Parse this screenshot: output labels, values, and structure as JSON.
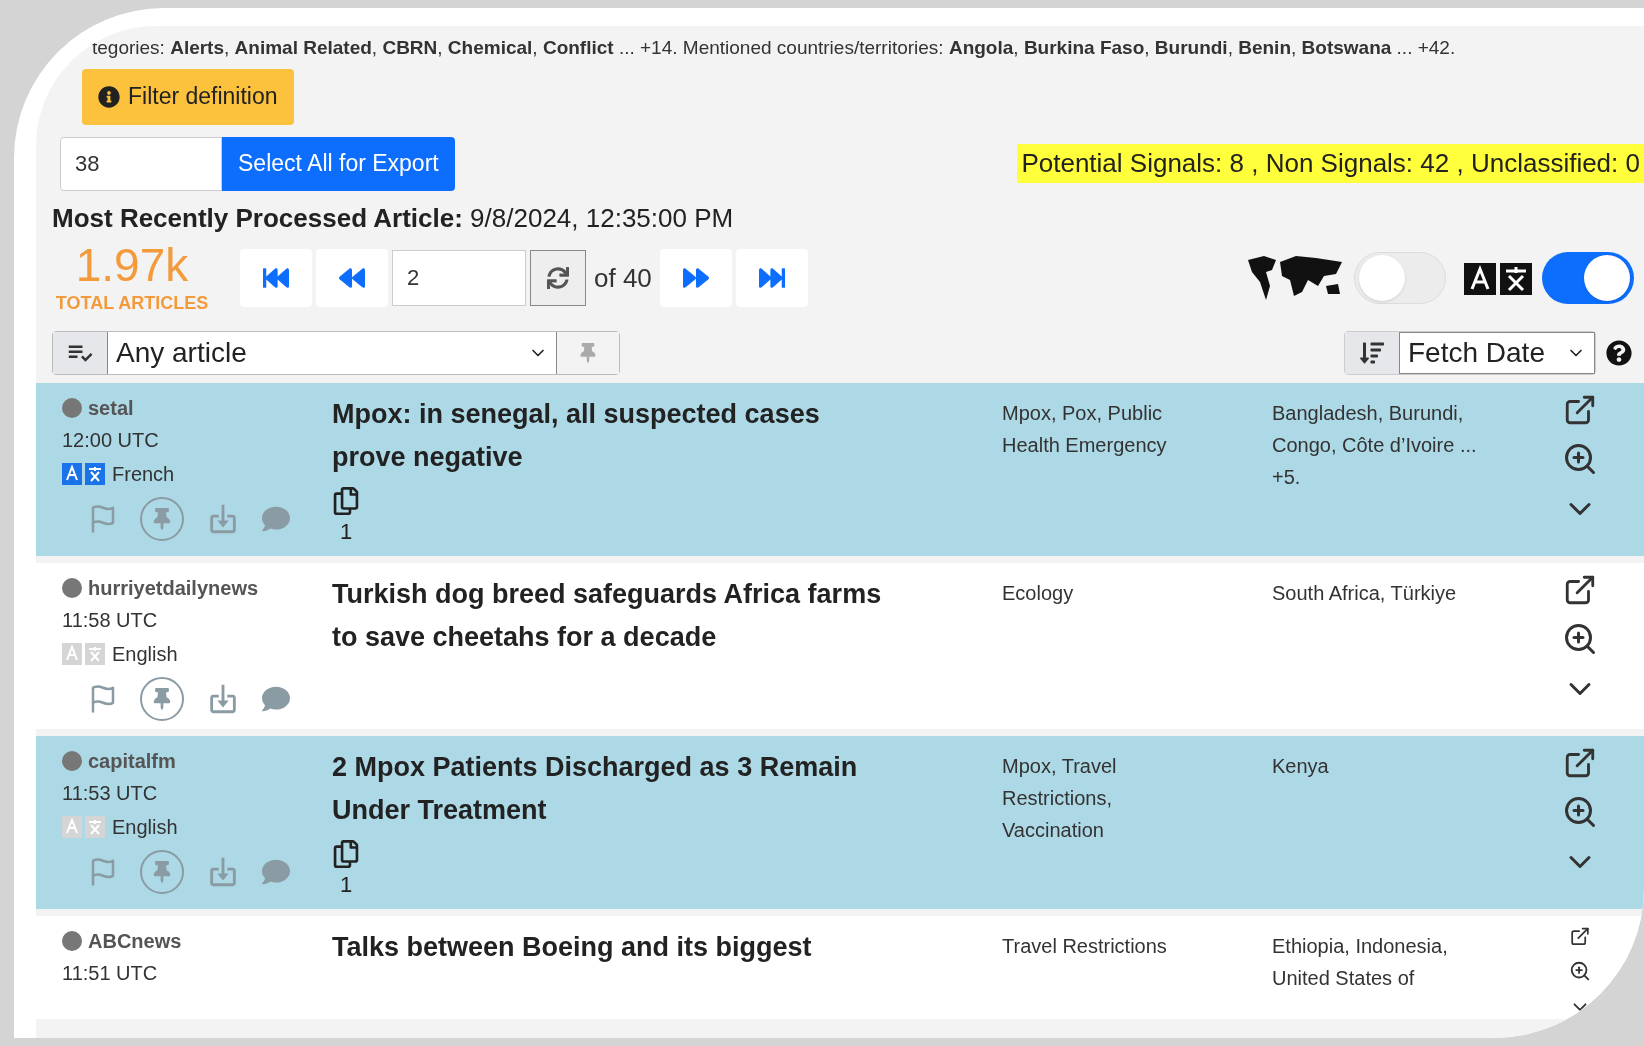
{
  "filter_summary": "tegories: **Alerts**, **Animal Related**, **CBRN**, **Chemical**, **Conflict** ... +14. Mentioned countries/territories: **Angola**, **Burkina Faso**, **Burundi**, **Benin**, **Botswana** ... +42.",
  "filter_button": "Filter definition",
  "export": {
    "count": "38",
    "button": "Select All for Export"
  },
  "signal_stats": "Potential Signals: 8 , Non Signals: 42 , Unclassified: 0",
  "recent": {
    "label": "Most Recently Processed Article:",
    "value": "9/8/2024, 12:35:00 PM"
  },
  "total": {
    "value": "1.97k",
    "label": "TOTAL ARTICLES"
  },
  "pager": {
    "page": "2",
    "of": "of 40"
  },
  "toggles": [
    {
      "kind": "map",
      "on": false
    },
    {
      "kind": "translate",
      "on": true
    }
  ],
  "article_filter": {
    "value": "Any article"
  },
  "sort": {
    "value": "Fetch Date"
  },
  "articles": [
    {
      "source": "setal",
      "time": "12:00 UTC",
      "language": "French",
      "translated": true,
      "highlighted": true,
      "title": "Mpox: in senegal, all suspected cases prove negative",
      "duplicates": "1",
      "categories": "Mpox, Pox, Public Health Emergency",
      "countries": "Bangladesh, Burundi, Congo, Côte d’Ivoire ... +5."
    },
    {
      "source": "hurriyetdailynews",
      "time": "11:58 UTC",
      "language": "English",
      "translated": false,
      "highlighted": false,
      "title": "Turkish dog breed safeguards Africa farms to save cheetahs for a decade",
      "categories": "Ecology",
      "countries": "South Africa, Türkiye"
    },
    {
      "source": "capitalfm",
      "time": "11:53 UTC",
      "language": "English",
      "translated": false,
      "highlighted": true,
      "title": "2 Mpox Patients Discharged as 3 Remain Under Treatment",
      "duplicates": "1",
      "categories": "Mpox, Travel Restrictions, Vaccination",
      "countries": "Kenya"
    },
    {
      "source": "ABCnews",
      "time": "11:51 UTC",
      "highlighted": false,
      "title": "Talks between Boeing and its biggest",
      "categories": "Travel Restrictions",
      "countries": "Ethiopia, Indonesia, United States of"
    }
  ]
}
